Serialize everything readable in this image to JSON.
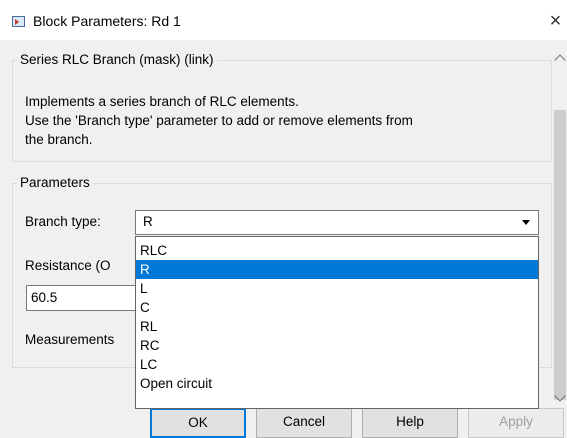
{
  "window": {
    "title": "Block Parameters: Rd 1",
    "close_glyph": "×"
  },
  "mask": {
    "header": "Series RLC Branch (mask) (link)",
    "description_lines": [
      "Implements a series branch of RLC elements.",
      "Use the 'Branch type' parameter to add or remove elements from",
      "the branch."
    ]
  },
  "parameters": {
    "header": "Parameters",
    "branch_type_label": "Branch type:",
    "branch_type_value": "R",
    "resistance_label": "Resistance (O",
    "resistance_value": "60.5",
    "measurements_label": "Measurements"
  },
  "dropdown": {
    "options": [
      "RLC",
      "R",
      "L",
      "C",
      "RL",
      "RC",
      "LC",
      "Open circuit"
    ],
    "selected_index": 1
  },
  "buttons": {
    "ok": "OK",
    "cancel": "Cancel",
    "help": "Help",
    "apply": "Apply"
  },
  "colors": {
    "selection": "#0078d7",
    "background": "#f0f0f0"
  }
}
